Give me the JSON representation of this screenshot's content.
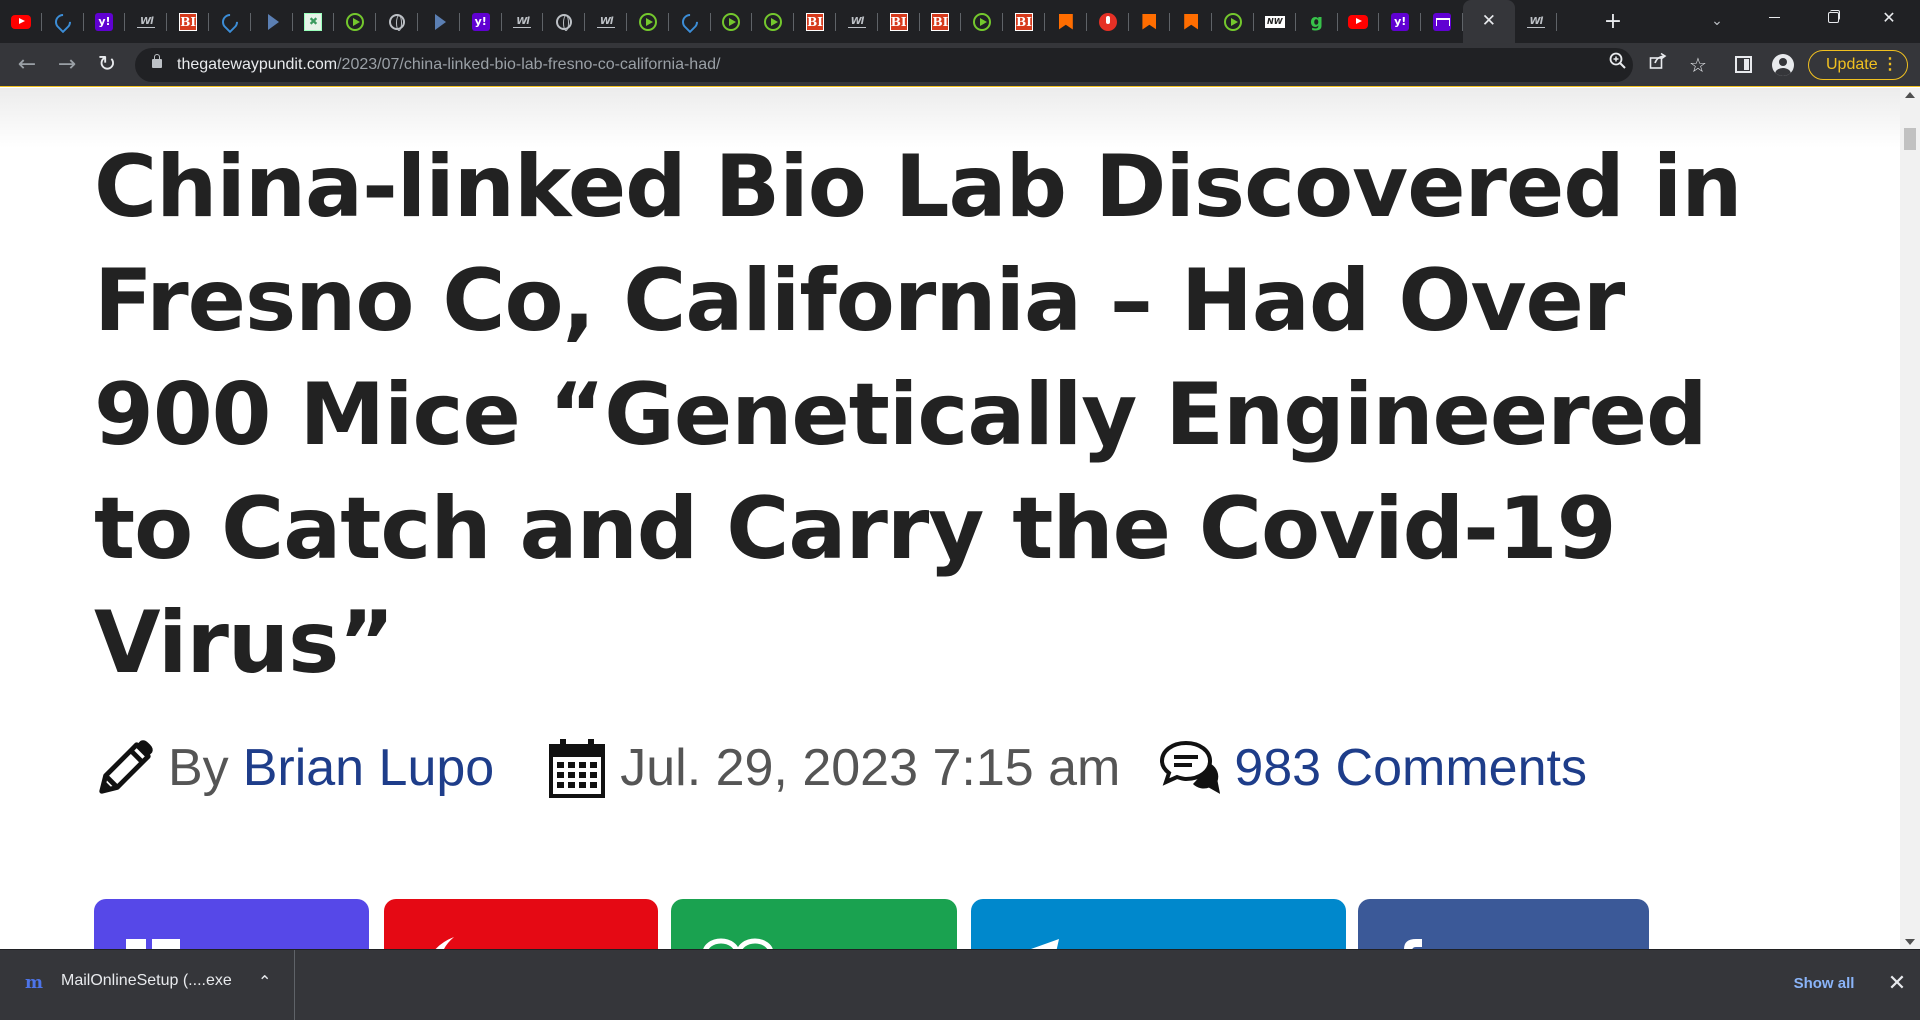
{
  "browser": {
    "tabs": [
      {
        "icon": "youtube-icon"
      },
      {
        "icon": "shield-icon"
      },
      {
        "icon": "yahoo-icon",
        "glyph": "y!"
      },
      {
        "icon": "wl-icon",
        "glyph": "Wl"
      },
      {
        "icon": "bi-icon",
        "glyph": "BI"
      },
      {
        "icon": "shield-icon"
      },
      {
        "icon": "arrow-icon"
      },
      {
        "icon": "grid-icon"
      },
      {
        "icon": "rumble-icon"
      },
      {
        "icon": "globe-icon"
      },
      {
        "icon": "arrow-icon"
      },
      {
        "icon": "yahoo-icon",
        "glyph": "y!"
      },
      {
        "icon": "wl-icon",
        "glyph": "Wl"
      },
      {
        "icon": "globe-icon"
      },
      {
        "icon": "wl-icon",
        "glyph": "Wl"
      },
      {
        "icon": "rumble-icon"
      },
      {
        "icon": "shield-icon"
      },
      {
        "icon": "rumble-icon"
      },
      {
        "icon": "rumble-icon"
      },
      {
        "icon": "bi-icon",
        "glyph": "BI"
      },
      {
        "icon": "wl-icon",
        "glyph": "Wl"
      },
      {
        "icon": "bi-icon",
        "glyph": "BI"
      },
      {
        "icon": "bi-icon",
        "glyph": "BI"
      },
      {
        "icon": "rumble-icon"
      },
      {
        "icon": "bi-icon",
        "glyph": "BI"
      },
      {
        "icon": "bookmark-icon"
      },
      {
        "icon": "podcast-icon"
      },
      {
        "icon": "bookmark-icon"
      },
      {
        "icon": "bookmark-icon"
      },
      {
        "icon": "rumble-icon"
      },
      {
        "icon": "news-icon",
        "glyph": "NW"
      },
      {
        "icon": "g-icon",
        "glyph": "g"
      },
      {
        "icon": "youtube-icon"
      },
      {
        "icon": "yahoo-icon",
        "glyph": "y!"
      },
      {
        "icon": "yahoo-mail-icon"
      },
      {
        "icon": "close-icon",
        "active": true,
        "glyph": "✕"
      },
      {
        "icon": "wl-icon",
        "glyph": "Wl"
      }
    ],
    "new_tab_glyph": "+",
    "tab_search_glyph": "⌄",
    "url_domain": "thegatewaypundit.com",
    "url_path": "/2023/07/china-linked-bio-lab-fresno-co-california-had/",
    "update_label": "Update",
    "update_menu_glyph": "⋮"
  },
  "article": {
    "headline": "China-linked Bio Lab Discovered in Fresno Co, California – Had Over 900 Mice “Genetically Engineered to Catch and Carry the Covid-19 Virus”",
    "by_label": "By",
    "author": "Brian Lupo",
    "date": "Jul. 29, 2023 7:15 am",
    "comments": "983 Comments"
  },
  "share_buttons": [
    {
      "name": "share-button-email",
      "color": "#5648e8"
    },
    {
      "name": "share-button-gab",
      "color": "#e50914"
    },
    {
      "name": "share-button-gettr",
      "color": "#1aa250"
    },
    {
      "name": "share-button-telegram",
      "color": "#0088cc"
    },
    {
      "name": "share-button-facebook",
      "color": "#3b5998"
    }
  ],
  "downloads": {
    "file_name": "MailOnlineSetup (....exe",
    "show_all": "Show all",
    "close_glyph": "✕"
  }
}
